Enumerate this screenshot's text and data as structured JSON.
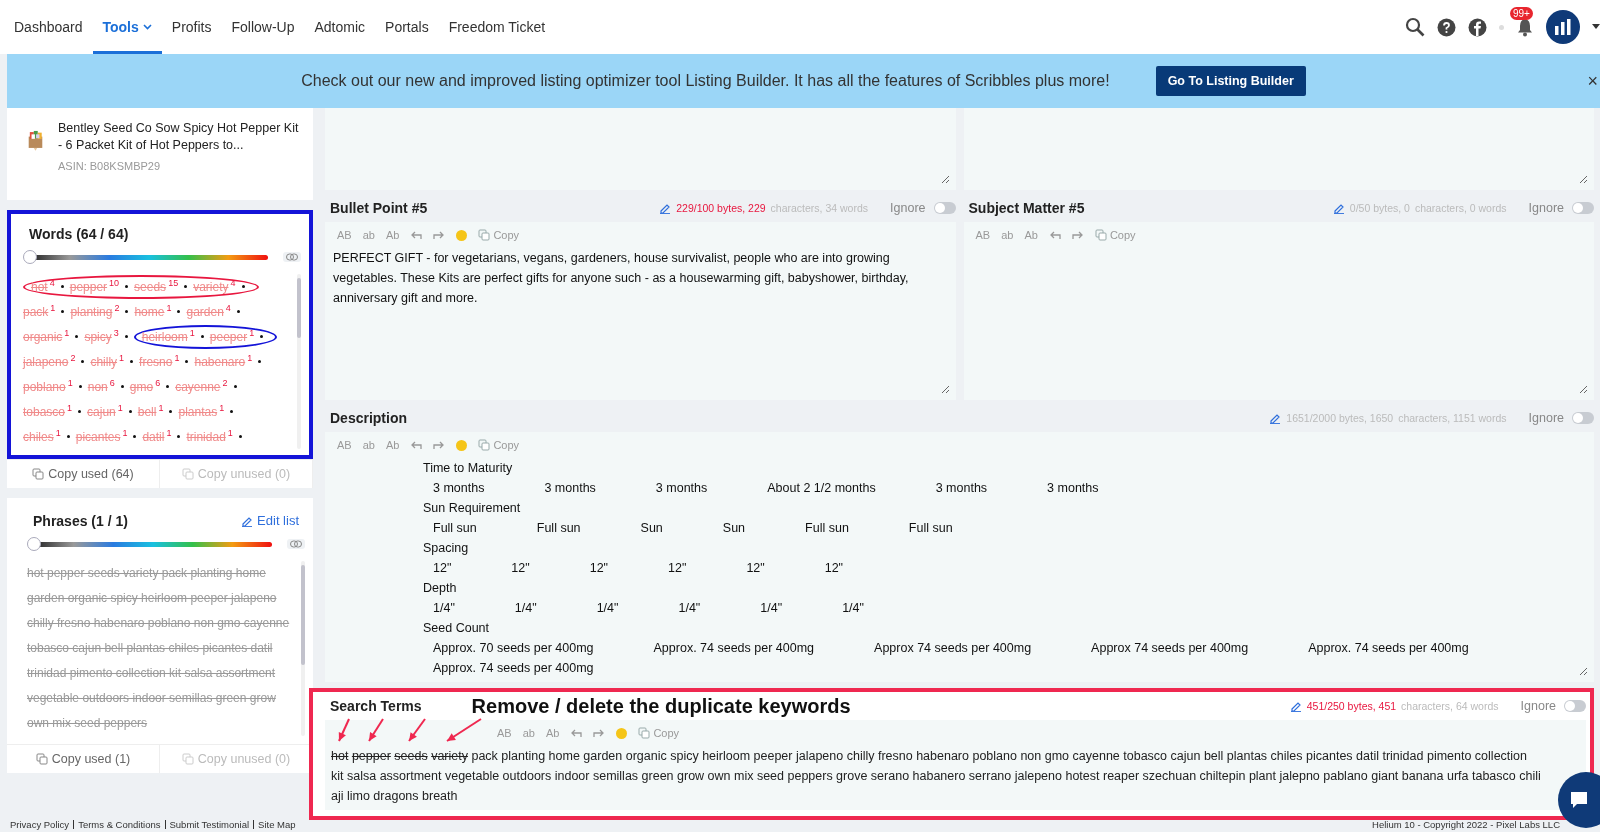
{
  "nav": {
    "items": [
      {
        "label": "Dashboard",
        "selected": false,
        "dropdown": false
      },
      {
        "label": "Tools",
        "selected": true,
        "dropdown": true
      },
      {
        "label": "Profits",
        "selected": false,
        "dropdown": false
      },
      {
        "label": "Follow-Up",
        "selected": false,
        "dropdown": false
      },
      {
        "label": "Adtomic",
        "selected": false,
        "dropdown": false
      },
      {
        "label": "Portals",
        "selected": false,
        "dropdown": false
      },
      {
        "label": "Freedom Ticket",
        "selected": false,
        "dropdown": false
      }
    ],
    "badge": "99+"
  },
  "banner": {
    "message": "Check out our new and improved listing optimizer tool Listing Builder. It has all the features of Scribbles plus more!",
    "button": "Go To Listing Builder",
    "close": "×"
  },
  "product": {
    "title": "Bentley Seed Co Sow Spicy Hot Pepper Kit - 6 Packet Kit of Hot Peppers to...",
    "asin": "ASIN: B08KSMBP29"
  },
  "words_panel": {
    "title": "Words (64 / 64)",
    "level": 0,
    "words": [
      {
        "text": "hot",
        "count": "4",
        "used": true,
        "color": "#e8173f"
      },
      {
        "text": "pepper",
        "count": "10",
        "used": true,
        "color": "#e8173f"
      },
      {
        "text": "seeds",
        "count": "15",
        "used": true,
        "color": "#e8173f"
      },
      {
        "text": "variety",
        "count": "4",
        "used": true,
        "color": "#e8173f"
      },
      {
        "text": "pack",
        "count": "1",
        "used": true
      },
      {
        "text": "planting",
        "count": "2",
        "used": true
      },
      {
        "text": "home",
        "count": "1",
        "used": true
      },
      {
        "text": "garden",
        "count": "4",
        "used": true
      },
      {
        "text": "organic",
        "count": "1",
        "used": true
      },
      {
        "text": "spicy",
        "count": "3",
        "used": true
      },
      {
        "text": "heirloom",
        "count": "1",
        "used": true,
        "color": "#1414d8"
      },
      {
        "text": "peeper",
        "count": "1",
        "used": true,
        "color": "#1414d8"
      },
      {
        "text": "jalapeno",
        "count": "2",
        "used": true
      },
      {
        "text": "chilly",
        "count": "1",
        "used": true
      },
      {
        "text": "fresno",
        "count": "1",
        "used": true
      },
      {
        "text": "habenaro",
        "count": "1",
        "used": true
      },
      {
        "text": "poblano",
        "count": "1",
        "used": true
      },
      {
        "text": "non",
        "count": "6",
        "used": true
      },
      {
        "text": "gmo",
        "count": "6",
        "used": true
      },
      {
        "text": "cayenne",
        "count": "2",
        "used": true
      },
      {
        "text": "tobasco",
        "count": "1",
        "used": true
      },
      {
        "text": "cajun",
        "count": "1",
        "used": true
      },
      {
        "text": "bell",
        "count": "1",
        "used": true
      },
      {
        "text": "plantas",
        "count": "1",
        "used": true
      },
      {
        "text": "chiles",
        "count": "1",
        "used": true
      },
      {
        "text": "picantes",
        "count": "1",
        "used": true
      },
      {
        "text": "datil",
        "count": "1",
        "used": true
      },
      {
        "text": "trinidad",
        "count": "1",
        "used": true
      }
    ],
    "copy": [
      {
        "label": "Copy used (64)",
        "disabled": false
      },
      {
        "label": "Copy unused (0)",
        "disabled": true
      }
    ]
  },
  "phrases_panel": {
    "title": "Phrases (1 / 1)",
    "edit": "Edit list",
    "level": 0,
    "phrases": [
      {
        "text": "hot pepper seeds variety pack planting home garden organic spicy heirloom peeper jalapeno chilly fresno habenaro poblano non gmo cayenne tobasco cajun bell plantas chiles picantes datil trinidad pimento collection kit salsa assortment vegetable outdoors indoor semillas green grow own mix seed peppers",
        "used": true
      }
    ],
    "copy": [
      {
        "label": "Copy used (1)",
        "disabled": false
      },
      {
        "label": "Copy unused (0)",
        "disabled": true
      }
    ]
  },
  "pair_fields": [
    {
      "title": "Bullet Point #5",
      "stats_count": "229/100 bytes, 229",
      "stats_rest": "characters, 34 words",
      "over_limit": true,
      "ignore_label": "Ignore",
      "ignored": false,
      "toolbar": {
        "cases": [
          "AB",
          "ab",
          "Ab"
        ],
        "emoji": true,
        "copy": "Copy"
      },
      "text": "PERFECT GIFT - for vegetarians, vegans, gardeners, house survivalist, people who are into growing vegetables. These Kits are perfect gifts for anyone such - as a housewarming gift, babyshower, birthday, anniversary gift and more."
    },
    {
      "title": "Subject Matter #5",
      "stats_count": "0/50 bytes, 0",
      "stats_rest": "characters, 0 words",
      "over_limit": false,
      "ignore_label": "Ignore",
      "ignored": false,
      "toolbar": {
        "cases": [
          "AB",
          "ab",
          "Ab"
        ],
        "emoji": false,
        "copy": "Copy"
      }
    }
  ],
  "description": {
    "title": "Description",
    "stats_count": "1651/2000 bytes, 1650",
    "stats_rest": "characters, 1151 words",
    "over_limit": false,
    "ignore_label": "Ignore",
    "ignored": false,
    "toolbar": {
      "cases": [
        "AB",
        "ab",
        "Ab"
      ],
      "emoji": true,
      "copy": "Copy"
    },
    "rows": [
      {
        "label": "Time to Maturity",
        "values": [
          "3 months",
          "3 months",
          "3 months",
          "About 2 1/2 months",
          "3 months",
          "3 months"
        ]
      },
      {
        "label": "Sun Requirement",
        "values": [
          "Full sun",
          "Full sun",
          "Sun",
          "Sun",
          "Full sun",
          "Full sun"
        ]
      },
      {
        "label": "Spacing",
        "values": [
          "12\"",
          "12\"",
          "12\"",
          "12\"",
          "12\"",
          "12\""
        ]
      },
      {
        "label": "Depth",
        "values": [
          "1/4\"",
          "1/4\"",
          "1/4\"",
          "1/4\"",
          "1/4\"",
          "1/4\""
        ]
      },
      {
        "label": "Seed Count",
        "values": [
          "Approx. 70 seeds per 400mg",
          "Approx. 74 seeds per 400mg",
          "Approx 74 seeds per 400mg",
          "Approx 74 seeds per 400mg",
          "Approx. 74 seeds per 400mg",
          "Approx. 74 seeds per 400mg"
        ]
      }
    ]
  },
  "search_terms": {
    "title": "Search Terms",
    "annotation": "Remove / delete the duplicate keywords",
    "stats_count": "451/250 bytes, 451",
    "stats_rest": "characters, 64 words",
    "over_limit": true,
    "ignore_label": "Ignore",
    "ignored": false,
    "toolbar": {
      "cases": [
        "AB",
        "ab",
        "Ab"
      ],
      "emoji": true,
      "copy": "Copy"
    },
    "terms": [
      {
        "text": "hot",
        "duplicate": true
      },
      {
        "text": "pepper",
        "duplicate": true
      },
      {
        "text": "seeds",
        "duplicate": true
      },
      {
        "text": "variety",
        "duplicate": true
      },
      {
        "text": "pack planting home garden organic spicy heirloom peeper jalapeno chilly fresno habenaro poblano non gmo cayenne tobasco cajun bell plantas chiles picantes datil trinidad pimento collection kit salsa assortment vegetable outdoors indoor semillas green grow own mix seed peppers grove serano habanero serrano jalepeno hotest reaper szechuan chiltepin plant jalepno pablano giant banana urfa tabasco chili aji limo dragons breath",
        "duplicate": false
      }
    ]
  },
  "footer": {
    "links": [
      "Privacy Policy",
      "Terms & Conditions",
      "Submit Testimonial",
      "Site Map"
    ],
    "copyright": "Helium 10 - Copyright 2022 - Pixel Labs LLC"
  }
}
